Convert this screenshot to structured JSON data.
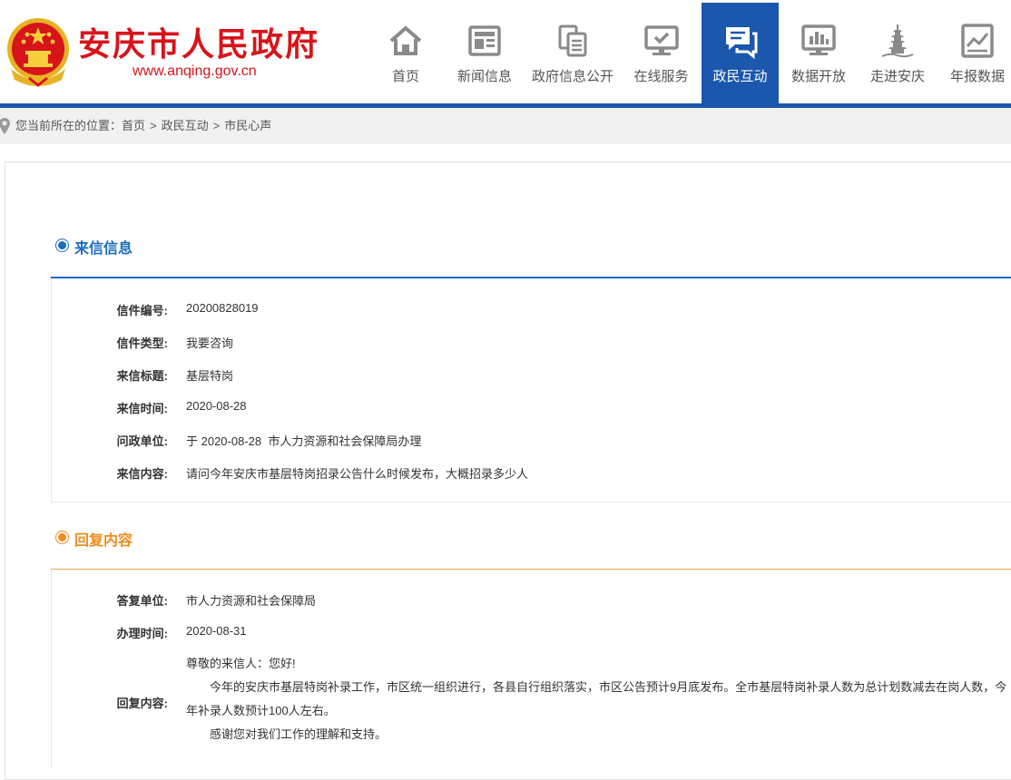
{
  "header": {
    "site_title": "安庆市人民政府",
    "site_url": "www.anqing.gov.cn",
    "brand_red": "#d7141a",
    "brand_blue": "#1a57ad",
    "nav": [
      {
        "label": "首页",
        "icon": "home-icon",
        "active": false
      },
      {
        "label": "新闻信息",
        "icon": "newspaper-icon",
        "active": false
      },
      {
        "label": "政府信息公开",
        "icon": "documents-icon",
        "active": false
      },
      {
        "label": "在线服务",
        "icon": "monitor-check-icon",
        "active": false
      },
      {
        "label": "政民互动",
        "icon": "chat-bubble-icon",
        "active": true
      },
      {
        "label": "数据开放",
        "icon": "bar-chart-monitor-icon",
        "active": false
      },
      {
        "label": "走进安庆",
        "icon": "pagoda-icon",
        "active": false
      },
      {
        "label": "年报数据",
        "icon": "report-chart-icon",
        "active": false
      }
    ]
  },
  "breadcrumb": {
    "prefix": "您当前所在的位置：",
    "items": [
      "首页",
      "政民互动",
      "市民心声"
    ],
    "separator": ">"
  },
  "letter": {
    "section_title": "来信信息",
    "accent": "#1a6bbf",
    "rows": [
      {
        "label": "信件编号:",
        "value": "20200828019"
      },
      {
        "label": "信件类型:",
        "value": "我要咨询"
      },
      {
        "label": "来信标题:",
        "value": "基层特岗"
      },
      {
        "label": "来信时间:",
        "value": "2020-08-28"
      },
      {
        "label": "问政单位:",
        "value": "于 2020-08-28  市人力资源和社会保障局办理"
      },
      {
        "label": "来信内容:",
        "value": "请问今年安庆市基层特岗招录公告什么时候发布，大概招录多少人"
      }
    ]
  },
  "reply": {
    "section_title": "回复内容",
    "accent": "#f08c1c",
    "rows": [
      {
        "label": "答复单位:",
        "value": "市人力资源和社会保障局"
      },
      {
        "label": "办理时间:",
        "value": "2020-08-31"
      }
    ],
    "content_label": "回复内容:",
    "content_lines": [
      "尊敬的来信人：您好!",
      "今年的安庆市基层特岗补录工作，市区统一组织进行，各县自行组织落实，市区公告预计9月底发布。全市基层特岗补录人数为总计划数减去在岗人数，今年补录人数预计100人左右。",
      "感谢您对我们工作的理解和支持。"
    ]
  }
}
